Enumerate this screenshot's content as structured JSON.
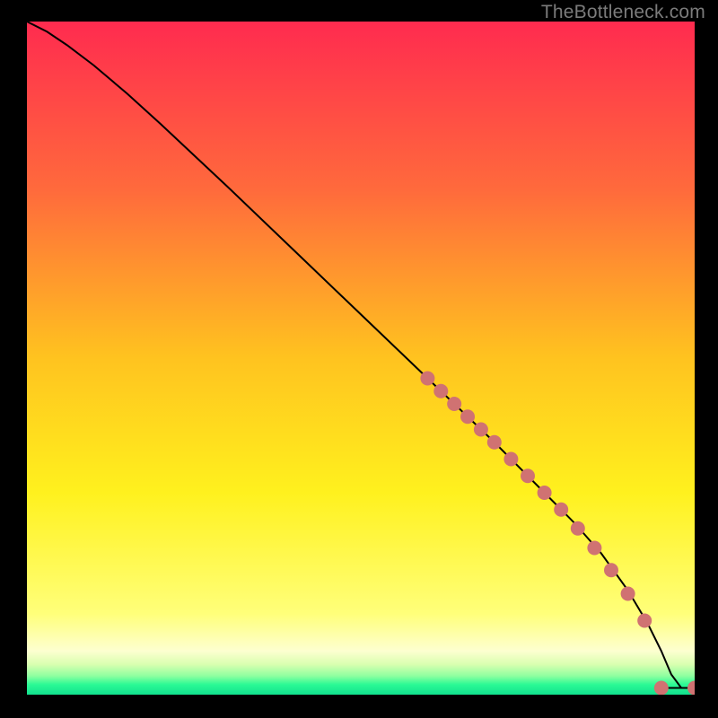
{
  "watermark": "TheBottleneck.com",
  "chart_data": {
    "type": "line",
    "title": "",
    "xlabel": "",
    "ylabel": "",
    "xlim": [
      0,
      100
    ],
    "ylim": [
      0,
      100
    ],
    "grid": false,
    "legend": false,
    "background_gradient_stops": [
      {
        "offset": 0.0,
        "color": "#ff2b4f"
      },
      {
        "offset": 0.25,
        "color": "#ff6a3c"
      },
      {
        "offset": 0.5,
        "color": "#ffc31f"
      },
      {
        "offset": 0.7,
        "color": "#fff11e"
      },
      {
        "offset": 0.88,
        "color": "#ffff7a"
      },
      {
        "offset": 0.935,
        "color": "#fdffd0"
      },
      {
        "offset": 0.955,
        "color": "#d9ffb0"
      },
      {
        "offset": 0.972,
        "color": "#8fffa0"
      },
      {
        "offset": 0.985,
        "color": "#2bfa95"
      },
      {
        "offset": 1.0,
        "color": "#11e08e"
      }
    ],
    "series": [
      {
        "name": "curve",
        "type": "line",
        "color": "#000000",
        "x": [
          0,
          3,
          6,
          10,
          15,
          20,
          30,
          40,
          50,
          60,
          70,
          78,
          82,
          86,
          90,
          93,
          95,
          96.5,
          98
        ],
        "y": [
          100,
          98.5,
          96.5,
          93.5,
          89.3,
          84.8,
          75.5,
          66.0,
          56.5,
          47.0,
          37.5,
          29.5,
          25.5,
          21.0,
          15.5,
          10.5,
          6.5,
          3.0,
          1.0
        ]
      },
      {
        "name": "end-segment",
        "type": "line",
        "color": "#000000",
        "x": [
          95,
          100
        ],
        "y": [
          1.0,
          1.0
        ]
      },
      {
        "name": "markers",
        "type": "scatter",
        "color": "#d07272",
        "radius_px": 8,
        "x": [
          60,
          62,
          64,
          66,
          68,
          70,
          72.5,
          75,
          77.5,
          80,
          82.5,
          85,
          87.5,
          90,
          92.5,
          95,
          100
        ],
        "y": [
          47.0,
          45.1,
          43.2,
          41.3,
          39.4,
          37.5,
          35.0,
          32.5,
          30.0,
          27.5,
          24.7,
          21.8,
          18.5,
          15.0,
          11.0,
          1.0,
          1.0
        ]
      }
    ]
  }
}
